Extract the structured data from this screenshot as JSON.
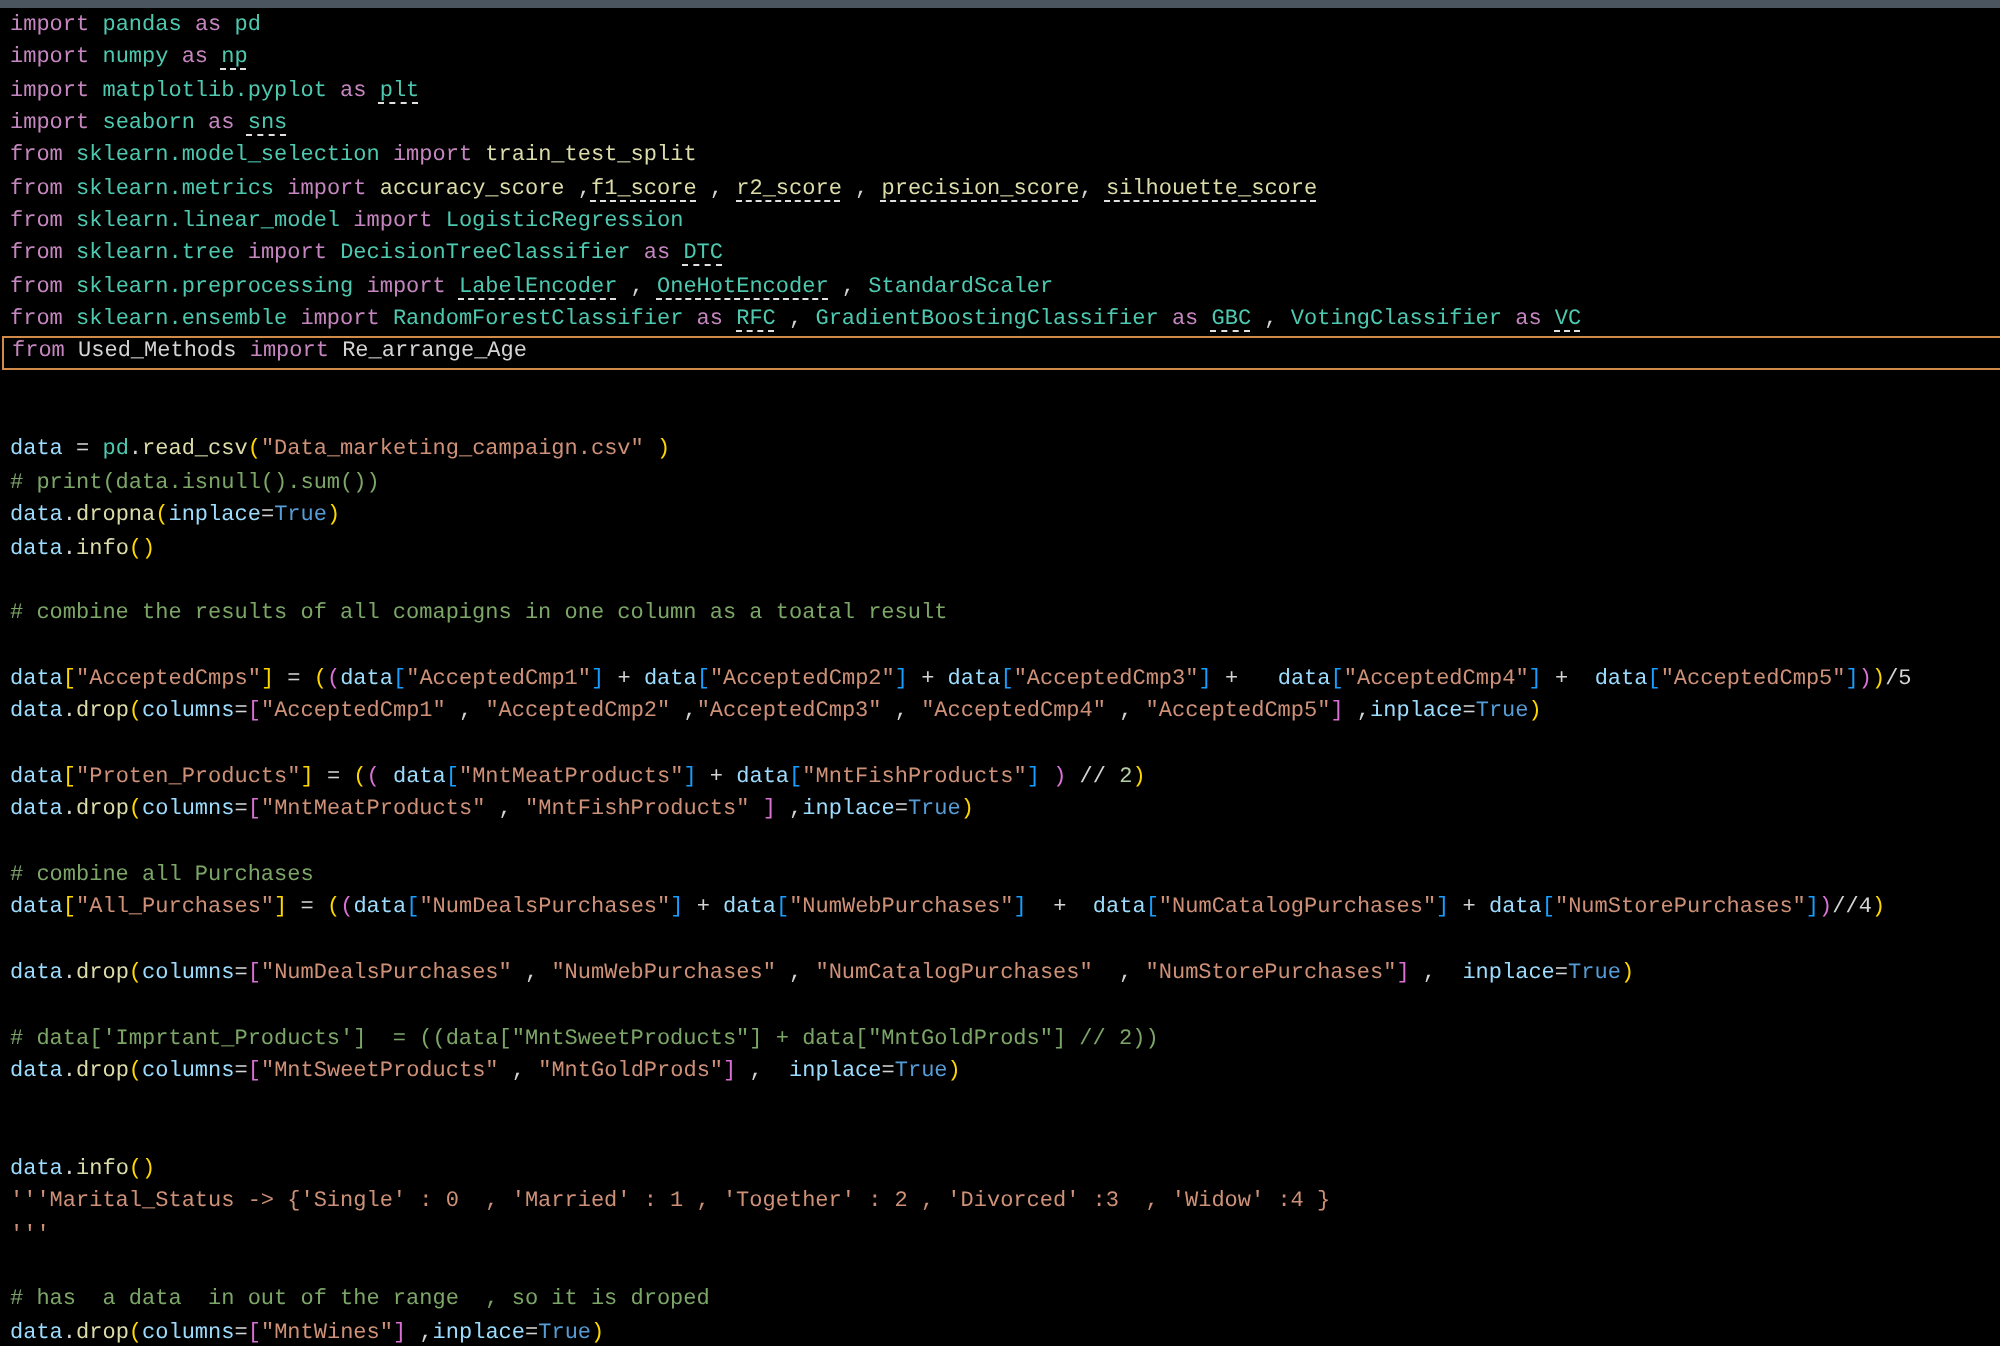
{
  "editor": {
    "lines": [
      {
        "kind": "code",
        "current": false,
        "tokens": [
          {
            "kind": "kw",
            "text": "import "
          },
          {
            "kind": "mod",
            "text": "pandas "
          },
          {
            "kind": "kw",
            "text": "as "
          },
          {
            "kind": "mod",
            "text": "pd"
          }
        ]
      },
      {
        "kind": "code",
        "current": false,
        "tokens": [
          {
            "kind": "kw",
            "text": "import "
          },
          {
            "kind": "mod",
            "text": "numpy "
          },
          {
            "kind": "kw",
            "text": "as "
          },
          {
            "kind": "unused-mod",
            "text": "np"
          }
        ]
      },
      {
        "kind": "code",
        "current": false,
        "tokens": [
          {
            "kind": "kw",
            "text": "import "
          },
          {
            "kind": "mod",
            "text": "matplotlib.pyplot "
          },
          {
            "kind": "kw",
            "text": "as "
          },
          {
            "kind": "unused-mod",
            "text": "plt"
          }
        ]
      },
      {
        "kind": "code",
        "current": false,
        "tokens": [
          {
            "kind": "kw",
            "text": "import "
          },
          {
            "kind": "mod",
            "text": "seaborn "
          },
          {
            "kind": "kw",
            "text": "as "
          },
          {
            "kind": "unused-mod",
            "text": "sns"
          }
        ]
      },
      {
        "kind": "code",
        "current": false,
        "tokens": [
          {
            "kind": "kw",
            "text": "from "
          },
          {
            "kind": "mod",
            "text": "sklearn.model_selection "
          },
          {
            "kind": "kw",
            "text": "import "
          },
          {
            "kind": "fn",
            "text": "train_test_split"
          }
        ]
      },
      {
        "kind": "code",
        "current": false,
        "tokens": [
          {
            "kind": "kw",
            "text": "from "
          },
          {
            "kind": "mod",
            "text": "sklearn.metrics "
          },
          {
            "kind": "kw",
            "text": "import "
          },
          {
            "kind": "fn",
            "text": "accuracy_score "
          },
          {
            "kind": "plain",
            "text": ","
          },
          {
            "kind": "unused-fn",
            "text": "f1_score"
          },
          {
            "kind": "plain",
            "text": " , "
          },
          {
            "kind": "unused-fn",
            "text": "r2_score"
          },
          {
            "kind": "plain",
            "text": " , "
          },
          {
            "kind": "unused-fn",
            "text": "precision_score"
          },
          {
            "kind": "plain",
            "text": ", "
          },
          {
            "kind": "unused-fn",
            "text": "silhouette_score"
          }
        ]
      },
      {
        "kind": "code",
        "current": false,
        "tokens": [
          {
            "kind": "kw",
            "text": "from "
          },
          {
            "kind": "mod",
            "text": "sklearn.linear_model "
          },
          {
            "kind": "kw",
            "text": "import "
          },
          {
            "kind": "cls",
            "text": "LogisticRegression"
          }
        ]
      },
      {
        "kind": "code",
        "current": false,
        "tokens": [
          {
            "kind": "kw",
            "text": "from "
          },
          {
            "kind": "mod",
            "text": "sklearn.tree "
          },
          {
            "kind": "kw",
            "text": "import "
          },
          {
            "kind": "cls",
            "text": "DecisionTreeClassifier "
          },
          {
            "kind": "kw",
            "text": "as "
          },
          {
            "kind": "unused-cls",
            "text": "DTC"
          }
        ]
      },
      {
        "kind": "code",
        "current": false,
        "tokens": [
          {
            "kind": "kw",
            "text": "from "
          },
          {
            "kind": "mod",
            "text": "sklearn.preprocessing "
          },
          {
            "kind": "kw",
            "text": "import "
          },
          {
            "kind": "unused-cls",
            "text": "LabelEncoder"
          },
          {
            "kind": "plain",
            "text": " , "
          },
          {
            "kind": "unused-cls",
            "text": "OneHotEncoder"
          },
          {
            "kind": "plain",
            "text": " , "
          },
          {
            "kind": "cls",
            "text": "StandardScaler"
          }
        ]
      },
      {
        "kind": "code",
        "current": false,
        "tokens": [
          {
            "kind": "kw",
            "text": "from "
          },
          {
            "kind": "mod",
            "text": "sklearn.ensemble "
          },
          {
            "kind": "kw",
            "text": "import "
          },
          {
            "kind": "cls",
            "text": "RandomForestClassifier "
          },
          {
            "kind": "kw",
            "text": "as "
          },
          {
            "kind": "unused-cls",
            "text": "RFC"
          },
          {
            "kind": "plain",
            "text": " , "
          },
          {
            "kind": "cls",
            "text": "GradientBoostingClassifier "
          },
          {
            "kind": "kw",
            "text": "as "
          },
          {
            "kind": "unused-cls",
            "text": "GBC"
          },
          {
            "kind": "plain",
            "text": " , "
          },
          {
            "kind": "cls",
            "text": "VotingClassifier "
          },
          {
            "kind": "kw",
            "text": "as "
          },
          {
            "kind": "unused-cls",
            "text": "VC"
          }
        ]
      },
      {
        "kind": "code",
        "current": true,
        "tokens": [
          {
            "kind": "kw",
            "text": "from "
          },
          {
            "kind": "plain",
            "text": "Used_Methods "
          },
          {
            "kind": "kw",
            "text": "import "
          },
          {
            "kind": "plain",
            "text": "Re_arrange_Age"
          }
        ]
      },
      {
        "kind": "blank",
        "current": false
      },
      {
        "kind": "blank",
        "current": false
      },
      {
        "kind": "code",
        "current": false,
        "tokens": [
          {
            "kind": "var",
            "text": "data"
          },
          {
            "kind": "plain",
            "text": " = "
          },
          {
            "kind": "mod",
            "text": "pd"
          },
          {
            "kind": "plain",
            "text": "."
          },
          {
            "kind": "fn",
            "text": "read_csv"
          },
          {
            "kind": "b1",
            "text": "("
          },
          {
            "kind": "str",
            "text": "\"Data_marketing_campaign.csv\""
          },
          {
            "kind": "b1",
            "text": " )"
          }
        ]
      },
      {
        "kind": "code",
        "current": false,
        "tokens": [
          {
            "kind": "cmt",
            "text": "# print(data.isnull().sum())"
          }
        ]
      },
      {
        "kind": "code",
        "current": false,
        "tokens": [
          {
            "kind": "var",
            "text": "data"
          },
          {
            "kind": "plain",
            "text": "."
          },
          {
            "kind": "fn",
            "text": "dropna"
          },
          {
            "kind": "b1",
            "text": "("
          },
          {
            "kind": "var",
            "text": "inplace"
          },
          {
            "kind": "plain",
            "text": "="
          },
          {
            "kind": "const",
            "text": "True"
          },
          {
            "kind": "b1",
            "text": ")"
          }
        ]
      },
      {
        "kind": "code",
        "current": false,
        "tokens": [
          {
            "kind": "var",
            "text": "data"
          },
          {
            "kind": "plain",
            "text": "."
          },
          {
            "kind": "fn",
            "text": "info"
          },
          {
            "kind": "b1",
            "text": "()"
          }
        ]
      },
      {
        "kind": "blank",
        "current": false
      },
      {
        "kind": "code",
        "current": false,
        "tokens": [
          {
            "kind": "cmt",
            "text": "# combine the results of all comapigns in one column as a toatal result"
          }
        ]
      },
      {
        "kind": "blank",
        "current": false
      },
      {
        "kind": "code",
        "current": false,
        "tokens": [
          {
            "kind": "var",
            "text": "data"
          },
          {
            "kind": "b1",
            "text": "["
          },
          {
            "kind": "str",
            "text": "\"AcceptedCmps\""
          },
          {
            "kind": "b1",
            "text": "]"
          },
          {
            "kind": "plain",
            "text": " = "
          },
          {
            "kind": "b1",
            "text": "("
          },
          {
            "kind": "b2",
            "text": "("
          },
          {
            "kind": "var",
            "text": "data"
          },
          {
            "kind": "b3",
            "text": "["
          },
          {
            "kind": "str",
            "text": "\"AcceptedCmp1\""
          },
          {
            "kind": "b3",
            "text": "]"
          },
          {
            "kind": "plain",
            "text": " + "
          },
          {
            "kind": "var",
            "text": "data"
          },
          {
            "kind": "b3",
            "text": "["
          },
          {
            "kind": "str",
            "text": "\"AcceptedCmp2\""
          },
          {
            "kind": "b3",
            "text": "]"
          },
          {
            "kind": "plain",
            "text": " + "
          },
          {
            "kind": "var",
            "text": "data"
          },
          {
            "kind": "b3",
            "text": "["
          },
          {
            "kind": "str",
            "text": "\"AcceptedCmp3\""
          },
          {
            "kind": "b3",
            "text": "]"
          },
          {
            "kind": "plain",
            "text": " +   "
          },
          {
            "kind": "var",
            "text": "data"
          },
          {
            "kind": "b3",
            "text": "["
          },
          {
            "kind": "str",
            "text": "\"AcceptedCmp4\""
          },
          {
            "kind": "b3",
            "text": "]"
          },
          {
            "kind": "plain",
            "text": " +  "
          },
          {
            "kind": "var",
            "text": "data"
          },
          {
            "kind": "b3",
            "text": "["
          },
          {
            "kind": "str",
            "text": "\"AcceptedCmp5\""
          },
          {
            "kind": "b3",
            "text": "]"
          },
          {
            "kind": "b2",
            "text": ")"
          },
          {
            "kind": "b1",
            "text": ")"
          },
          {
            "kind": "plain",
            "text": "/5"
          }
        ]
      },
      {
        "kind": "code",
        "current": false,
        "tokens": [
          {
            "kind": "var",
            "text": "data"
          },
          {
            "kind": "plain",
            "text": "."
          },
          {
            "kind": "fn",
            "text": "drop"
          },
          {
            "kind": "b1",
            "text": "("
          },
          {
            "kind": "var",
            "text": "columns"
          },
          {
            "kind": "plain",
            "text": "="
          },
          {
            "kind": "b2",
            "text": "["
          },
          {
            "kind": "str",
            "text": "\"AcceptedCmp1\""
          },
          {
            "kind": "plain",
            "text": " , "
          },
          {
            "kind": "str",
            "text": "\"AcceptedCmp2\""
          },
          {
            "kind": "plain",
            "text": " ,"
          },
          {
            "kind": "str",
            "text": "\"AcceptedCmp3\""
          },
          {
            "kind": "plain",
            "text": " , "
          },
          {
            "kind": "str",
            "text": "\"AcceptedCmp4\""
          },
          {
            "kind": "plain",
            "text": " , "
          },
          {
            "kind": "str",
            "text": "\"AcceptedCmp5\""
          },
          {
            "kind": "b2",
            "text": "]"
          },
          {
            "kind": "plain",
            "text": " ,"
          },
          {
            "kind": "var",
            "text": "inplace"
          },
          {
            "kind": "plain",
            "text": "="
          },
          {
            "kind": "const",
            "text": "True"
          },
          {
            "kind": "b1",
            "text": ")"
          }
        ]
      },
      {
        "kind": "blank",
        "current": false
      },
      {
        "kind": "code",
        "current": false,
        "tokens": [
          {
            "kind": "var",
            "text": "data"
          },
          {
            "kind": "b1",
            "text": "["
          },
          {
            "kind": "str",
            "text": "\"Proten_Products\""
          },
          {
            "kind": "b1",
            "text": "]"
          },
          {
            "kind": "plain",
            "text": " = "
          },
          {
            "kind": "b1",
            "text": "("
          },
          {
            "kind": "b2",
            "text": "( "
          },
          {
            "kind": "var",
            "text": "data"
          },
          {
            "kind": "b3",
            "text": "["
          },
          {
            "kind": "str",
            "text": "\"MntMeatProducts\""
          },
          {
            "kind": "b3",
            "text": "]"
          },
          {
            "kind": "plain",
            "text": " + "
          },
          {
            "kind": "var",
            "text": "data"
          },
          {
            "kind": "b3",
            "text": "["
          },
          {
            "kind": "str",
            "text": "\"MntFishProducts\""
          },
          {
            "kind": "b3",
            "text": "]"
          },
          {
            "kind": "b2",
            "text": " )"
          },
          {
            "kind": "plain",
            "text": " // "
          },
          {
            "kind": "num",
            "text": "2"
          },
          {
            "kind": "b1",
            "text": ")"
          }
        ]
      },
      {
        "kind": "code",
        "current": false,
        "tokens": [
          {
            "kind": "var",
            "text": "data"
          },
          {
            "kind": "plain",
            "text": "."
          },
          {
            "kind": "fn",
            "text": "drop"
          },
          {
            "kind": "b1",
            "text": "("
          },
          {
            "kind": "var",
            "text": "columns"
          },
          {
            "kind": "plain",
            "text": "="
          },
          {
            "kind": "b2",
            "text": "["
          },
          {
            "kind": "str",
            "text": "\"MntMeatProducts\""
          },
          {
            "kind": "plain",
            "text": " , "
          },
          {
            "kind": "str",
            "text": "\"MntFishProducts\""
          },
          {
            "kind": "b2",
            "text": " ]"
          },
          {
            "kind": "plain",
            "text": " ,"
          },
          {
            "kind": "var",
            "text": "inplace"
          },
          {
            "kind": "plain",
            "text": "="
          },
          {
            "kind": "const",
            "text": "True"
          },
          {
            "kind": "b1",
            "text": ")"
          }
        ]
      },
      {
        "kind": "blank",
        "current": false
      },
      {
        "kind": "code",
        "current": false,
        "tokens": [
          {
            "kind": "cmt",
            "text": "# combine all Purchases"
          }
        ]
      },
      {
        "kind": "code",
        "current": false,
        "tokens": [
          {
            "kind": "var",
            "text": "data"
          },
          {
            "kind": "b1",
            "text": "["
          },
          {
            "kind": "str",
            "text": "\"All_Purchases\""
          },
          {
            "kind": "b1",
            "text": "]"
          },
          {
            "kind": "plain",
            "text": " = "
          },
          {
            "kind": "b1",
            "text": "("
          },
          {
            "kind": "b2",
            "text": "("
          },
          {
            "kind": "var",
            "text": "data"
          },
          {
            "kind": "b3",
            "text": "["
          },
          {
            "kind": "str",
            "text": "\"NumDealsPurchases\""
          },
          {
            "kind": "b3",
            "text": "]"
          },
          {
            "kind": "plain",
            "text": " + "
          },
          {
            "kind": "var",
            "text": "data"
          },
          {
            "kind": "b3",
            "text": "["
          },
          {
            "kind": "str",
            "text": "\"NumWebPurchases\""
          },
          {
            "kind": "b3",
            "text": "]"
          },
          {
            "kind": "plain",
            "text": "  +  "
          },
          {
            "kind": "var",
            "text": "data"
          },
          {
            "kind": "b3",
            "text": "["
          },
          {
            "kind": "str",
            "text": "\"NumCatalogPurchases\""
          },
          {
            "kind": "b3",
            "text": "]"
          },
          {
            "kind": "plain",
            "text": " + "
          },
          {
            "kind": "var",
            "text": "data"
          },
          {
            "kind": "b3",
            "text": "["
          },
          {
            "kind": "str",
            "text": "\"NumStorePurchases\""
          },
          {
            "kind": "b3",
            "text": "]"
          },
          {
            "kind": "b2",
            "text": ")"
          },
          {
            "kind": "plain",
            "text": "//4"
          },
          {
            "kind": "b1",
            "text": ")"
          }
        ]
      },
      {
        "kind": "blank",
        "current": false
      },
      {
        "kind": "code",
        "current": false,
        "tokens": [
          {
            "kind": "var",
            "text": "data"
          },
          {
            "kind": "plain",
            "text": "."
          },
          {
            "kind": "fn",
            "text": "drop"
          },
          {
            "kind": "b1",
            "text": "("
          },
          {
            "kind": "var",
            "text": "columns"
          },
          {
            "kind": "plain",
            "text": "="
          },
          {
            "kind": "b2",
            "text": "["
          },
          {
            "kind": "str",
            "text": "\"NumDealsPurchases\""
          },
          {
            "kind": "plain",
            "text": " , "
          },
          {
            "kind": "str",
            "text": "\"NumWebPurchases\""
          },
          {
            "kind": "plain",
            "text": " , "
          },
          {
            "kind": "str",
            "text": "\"NumCatalogPurchases\""
          },
          {
            "kind": "plain",
            "text": "  , "
          },
          {
            "kind": "str",
            "text": "\"NumStorePurchases\""
          },
          {
            "kind": "b2",
            "text": "]"
          },
          {
            "kind": "plain",
            "text": " ,  "
          },
          {
            "kind": "var",
            "text": "inplace"
          },
          {
            "kind": "plain",
            "text": "="
          },
          {
            "kind": "const",
            "text": "True"
          },
          {
            "kind": "b1",
            "text": ")"
          }
        ]
      },
      {
        "kind": "blank",
        "current": false
      },
      {
        "kind": "code",
        "current": false,
        "tokens": [
          {
            "kind": "cmt",
            "text": "# data['Imprtant_Products']  = ((data[\"MntSweetProducts\"] + data[\"MntGoldProds\"] // 2))"
          }
        ]
      },
      {
        "kind": "code",
        "current": false,
        "tokens": [
          {
            "kind": "var",
            "text": "data"
          },
          {
            "kind": "plain",
            "text": "."
          },
          {
            "kind": "fn",
            "text": "drop"
          },
          {
            "kind": "b1",
            "text": "("
          },
          {
            "kind": "var",
            "text": "columns"
          },
          {
            "kind": "plain",
            "text": "="
          },
          {
            "kind": "b2",
            "text": "["
          },
          {
            "kind": "str",
            "text": "\"MntSweetProducts\""
          },
          {
            "kind": "plain",
            "text": " , "
          },
          {
            "kind": "str",
            "text": "\"MntGoldProds\""
          },
          {
            "kind": "b2",
            "text": "]"
          },
          {
            "kind": "plain",
            "text": " ,  "
          },
          {
            "kind": "var",
            "text": "inplace"
          },
          {
            "kind": "plain",
            "text": "="
          },
          {
            "kind": "const",
            "text": "True"
          },
          {
            "kind": "b1",
            "text": ")"
          }
        ]
      },
      {
        "kind": "blank",
        "current": false
      },
      {
        "kind": "blank",
        "current": false
      },
      {
        "kind": "code",
        "current": false,
        "tokens": [
          {
            "kind": "var",
            "text": "data"
          },
          {
            "kind": "plain",
            "text": "."
          },
          {
            "kind": "fn",
            "text": "info"
          },
          {
            "kind": "b1",
            "text": "()"
          }
        ]
      },
      {
        "kind": "code",
        "current": false,
        "tokens": [
          {
            "kind": "str",
            "text": "'''Marital_Status -> {'Single' : 0  , 'Married' : 1 , 'Together' : 2 , 'Divorced' :3  , 'Widow' :4 }"
          }
        ]
      },
      {
        "kind": "code",
        "current": false,
        "tokens": [
          {
            "kind": "str",
            "text": "'''"
          }
        ]
      },
      {
        "kind": "blank",
        "current": false
      },
      {
        "kind": "code",
        "current": false,
        "tokens": [
          {
            "kind": "cmt",
            "text": "# has  a data  in out of the range  , so it is droped"
          }
        ]
      },
      {
        "kind": "code",
        "current": false,
        "tokens": [
          {
            "kind": "var",
            "text": "data"
          },
          {
            "kind": "plain",
            "text": "."
          },
          {
            "kind": "fn",
            "text": "drop"
          },
          {
            "kind": "b1",
            "text": "("
          },
          {
            "kind": "var",
            "text": "columns"
          },
          {
            "kind": "plain",
            "text": "="
          },
          {
            "kind": "b2",
            "text": "["
          },
          {
            "kind": "str",
            "text": "\"MntWines\""
          },
          {
            "kind": "b2",
            "text": "]"
          },
          {
            "kind": "plain",
            "text": " ,"
          },
          {
            "kind": "var",
            "text": "inplace"
          },
          {
            "kind": "plain",
            "text": "="
          },
          {
            "kind": "const",
            "text": "True"
          },
          {
            "kind": "b1",
            "text": ")"
          }
        ]
      }
    ]
  }
}
